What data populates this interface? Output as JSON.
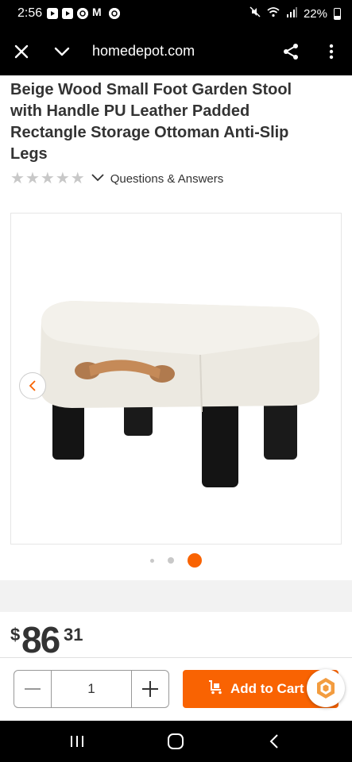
{
  "status_bar": {
    "time": "2:56",
    "mail_icon_label": "M",
    "battery_text": "22%",
    "icons": [
      "youtube-icon",
      "youtube-icon",
      "app-icon",
      "gmail-icon",
      "app-icon",
      "mute-icon",
      "wifi-icon",
      "signal-icon",
      "battery-icon"
    ]
  },
  "browser": {
    "url": "homedepot.com",
    "icons": [
      "close-icon",
      "chevron-down-icon",
      "share-icon",
      "more-vert-icon"
    ]
  },
  "product": {
    "title": "Beige Wood Small Foot Garden Stool with Handle PU Leather Padded Rectangle Storage Ottoman Anti-Slip Legs",
    "stars_filled": 0,
    "stars_total": 5,
    "qa_link": "Questions & Answers"
  },
  "gallery": {
    "total_images": 3,
    "active_index": 2
  },
  "price": {
    "symbol": "$",
    "dollars": "86",
    "cents": "31"
  },
  "cart": {
    "quantity": "1",
    "add_label": "Add to Cart"
  },
  "colors": {
    "brand_orange": "#f96302",
    "star_empty": "#c8c8c8",
    "text_dark": "#333333"
  }
}
